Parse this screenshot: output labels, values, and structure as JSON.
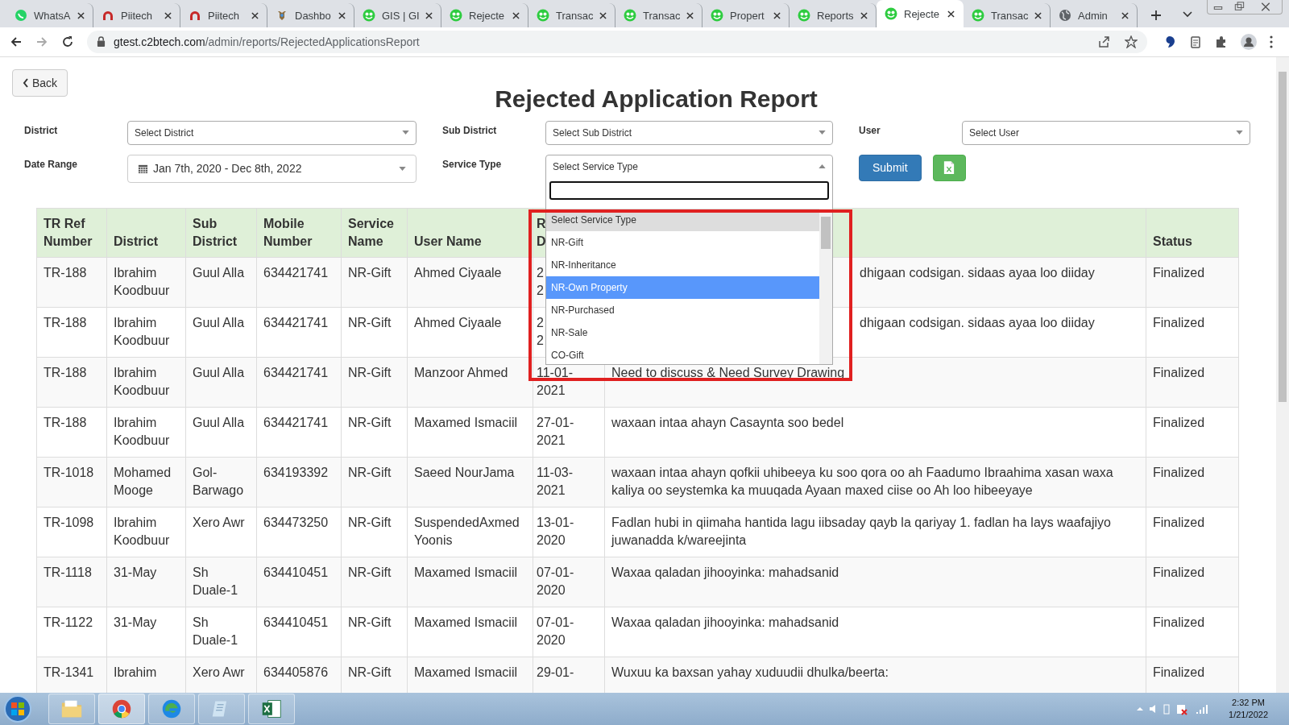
{
  "browser": {
    "tabs": [
      {
        "title": "WhatsA",
        "kind": "whatsapp",
        "selected": false
      },
      {
        "title": "Piitech",
        "kind": "arch",
        "selected": false
      },
      {
        "title": "Piitech",
        "kind": "arch",
        "selected": false
      },
      {
        "title": "Dashbo",
        "kind": "emblem",
        "selected": false
      },
      {
        "title": "GIS | GI",
        "kind": "app",
        "selected": false
      },
      {
        "title": "Rejecte",
        "kind": "app",
        "selected": false
      },
      {
        "title": "Transac",
        "kind": "app",
        "selected": false
      },
      {
        "title": "Transac",
        "kind": "app",
        "selected": false
      },
      {
        "title": "Propert",
        "kind": "app",
        "selected": false
      },
      {
        "title": "Reports",
        "kind": "app",
        "selected": false
      },
      {
        "title": "Rejecte",
        "kind": "app",
        "selected": true
      },
      {
        "title": "Transac",
        "kind": "app",
        "selected": false
      },
      {
        "title": "Admin",
        "kind": "globe",
        "selected": false
      }
    ],
    "address": {
      "host": "gtest.c2btech.com",
      "path": "/admin/reports/RejectedApplicationsReport"
    }
  },
  "page": {
    "back": "Back",
    "title": "Rejected Application Report",
    "filters": [
      {
        "label": "District",
        "kind": "select",
        "value": "Select District",
        "expanded": false
      },
      {
        "label": "Sub District",
        "kind": "select",
        "value": "Select Sub District",
        "expanded": false
      },
      {
        "label": "User",
        "kind": "select",
        "value": "Select User",
        "expanded": false
      },
      {
        "label": "Date Range",
        "kind": "date",
        "value": "Jan 7th, 2020 - Dec 8th, 2022",
        "expanded": false
      },
      {
        "label": "Service Type",
        "kind": "select",
        "value": "Select Service Type",
        "expanded": true
      }
    ],
    "submit": "Submit",
    "options": [
      {
        "label": "Select Service Type",
        "selected": true,
        "highlighted": false
      },
      {
        "label": "NR-Gift",
        "selected": false,
        "highlighted": false
      },
      {
        "label": "NR-Inheritance",
        "selected": false,
        "highlighted": false
      },
      {
        "label": "NR-Own Property",
        "selected": false,
        "highlighted": true
      },
      {
        "label": "NR-Purchased",
        "selected": false,
        "highlighted": false
      },
      {
        "label": "NR-Sale",
        "selected": false,
        "highlighted": false
      },
      {
        "label": "CO-Gift",
        "selected": false,
        "highlighted": false
      }
    ],
    "table": {
      "columns": [
        "TR Ref Number",
        "District",
        "Sub District",
        "Mobile Number",
        "Service Name",
        "User Name",
        "R\nD",
        null,
        "Status"
      ],
      "rows": [
        {
          "covered": true,
          "cells": [
            "TR-188",
            "Ibrahim Koodbuur",
            "Guul Alla",
            "634421741",
            "NR-Gift",
            "Ahmed Ciyaale",
            "2\n2",
            "dhigaan codsigan. sidaas ayaa loo diiday",
            "Finalized"
          ]
        },
        {
          "covered": true,
          "cells": [
            "TR-188",
            "Ibrahim Koodbuur",
            "Guul Alla",
            "634421741",
            "NR-Gift",
            "Ahmed Ciyaale",
            "2\n2",
            "dhigaan codsigan. sidaas ayaa loo diiday",
            "Finalized"
          ]
        },
        {
          "covered": false,
          "cells": [
            "TR-188",
            "Ibrahim Koodbuur",
            "Guul Alla",
            "634421741",
            "NR-Gift",
            "Manzoor Ahmed",
            "11-01-2021",
            "Need to discuss & Need Survey Drawing",
            "Finalized"
          ]
        },
        {
          "covered": false,
          "cells": [
            "TR-188",
            "Ibrahim Koodbuur",
            "Guul Alla",
            "634421741",
            "NR-Gift",
            "Maxamed Ismaciil",
            "27-01-2021",
            "waxaan intaa ahayn Casaynta soo bedel",
            "Finalized"
          ]
        },
        {
          "covered": false,
          "cells": [
            "TR-1018",
            "Mohamed Mooge",
            "Gol-Barwago",
            "634193392",
            "NR-Gift",
            "Saeed NourJama",
            "11-03-2021",
            "waxaan intaa ahayn qofkii uhibeeya ku soo qora oo ah Faadumo Ibraahima xasan waxa kaliya oo seystemka ka muuqada Ayaan maxed ciise oo Ah loo hibeeyaye",
            "Finalized"
          ]
        },
        {
          "covered": false,
          "cells": [
            "TR-1098",
            "Ibrahim Koodbuur",
            "Xero Awr",
            "634473250",
            "NR-Gift",
            "SuspendedAxmed Yoonis",
            "13-01-2020",
            "Fadlan hubi in qiimaha hantida lagu iibsaday qayb la qariyay 1. fadlan ha lays waafajiyo juwanadda k/wareejinta",
            "Finalized"
          ]
        },
        {
          "covered": false,
          "cells": [
            "TR-1118",
            "31-May",
            "Sh Duale-1",
            "634410451",
            "NR-Gift",
            "Maxamed Ismaciil",
            "07-01-2020",
            "Waxaa qaladan jihooyinka: mahadsanid",
            "Finalized"
          ]
        },
        {
          "covered": false,
          "cells": [
            "TR-1122",
            "31-May",
            "Sh Duale-1",
            "634410451",
            "NR-Gift",
            "Maxamed Ismaciil",
            "07-01-2020",
            "Waxaa qaladan jihooyinka: mahadsanid",
            "Finalized"
          ]
        },
        {
          "covered": false,
          "cells": [
            "TR-1341",
            "Ibrahim",
            "Xero Awr",
            "634405876",
            "NR-Gift",
            "Maxamed Ismaciil",
            "29-01-",
            "Wuxuu ka baxsan yahay xuduudii dhulka/beerta:",
            "Finalized"
          ]
        }
      ]
    }
  },
  "taskbar": {
    "time": "2:32 PM",
    "date": "1/21/2022"
  }
}
